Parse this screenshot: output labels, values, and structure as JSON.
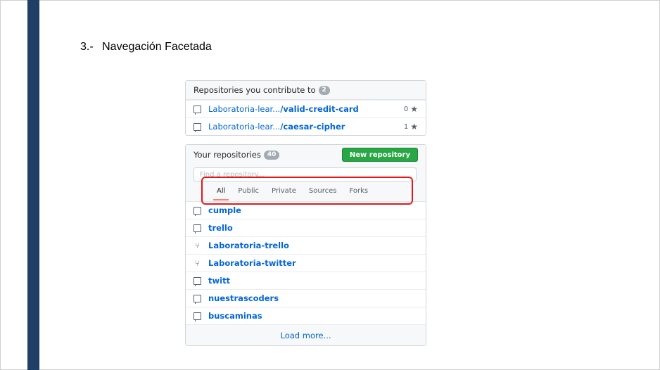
{
  "heading": {
    "number": "3.-",
    "text": "Navegación Facetada"
  },
  "contribute": {
    "title": "Repositories you contribute to",
    "count": "2",
    "repos": [
      {
        "owner": "Laboratoria-lear...",
        "name": "/valid-credit-card",
        "stars": "0"
      },
      {
        "owner": "Laboratoria-lear...",
        "name": "/caesar-cipher",
        "stars": "1"
      }
    ]
  },
  "yours": {
    "title": "Your repositories",
    "count": "40",
    "new_button": "New repository",
    "search_placeholder": "Find a repository...",
    "tabs": [
      "All",
      "Public",
      "Private",
      "Sources",
      "Forks"
    ],
    "repos": [
      {
        "name": "cumple",
        "icon": "repo-icon"
      },
      {
        "name": "trello",
        "icon": "repo-icon"
      },
      {
        "name": "Laboratoria-trello",
        "icon": "fork-icon"
      },
      {
        "name": "Laboratoria-twitter",
        "icon": "fork-icon"
      },
      {
        "name": "twitt",
        "icon": "repo-icon"
      },
      {
        "name": "nuestrascoders",
        "icon": "repo-icon"
      },
      {
        "name": "buscaminas",
        "icon": "repo-icon"
      }
    ],
    "load_more": "Load more..."
  },
  "colors": {
    "sidebar": "#1f3f66",
    "highlight": "#e0191b",
    "link": "#0366d6",
    "button": "#28a745"
  }
}
